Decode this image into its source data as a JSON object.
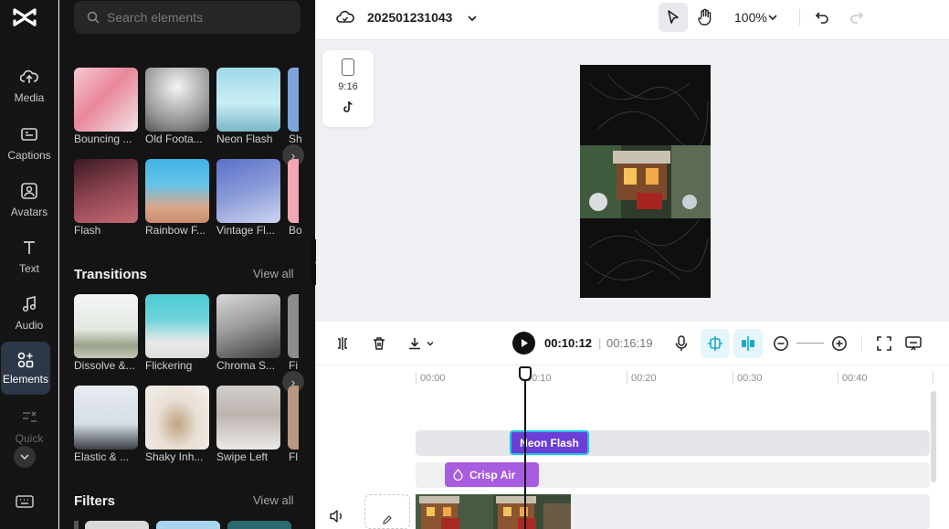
{
  "rail": {
    "items": [
      {
        "label": "Media",
        "icon": "cloud-upload-icon"
      },
      {
        "label": "Captions",
        "icon": "captions-icon"
      },
      {
        "label": "Avatars",
        "icon": "avatar-icon"
      },
      {
        "label": "Text",
        "icon": "text-icon"
      },
      {
        "label": "Audio",
        "icon": "music-note-icon"
      },
      {
        "label": "Elements",
        "icon": "elements-icon",
        "active": true
      },
      {
        "label": "Quick",
        "icon": "quick-tools-icon"
      }
    ]
  },
  "panel": {
    "search_placeholder": "Search elements",
    "effects_row1": [
      "Bouncing ...",
      "Old Foota...",
      "Neon Flash",
      "Sh"
    ],
    "effects_row2": [
      "Flash",
      "Rainbow F...",
      "Vintage Fl...",
      "Bo"
    ],
    "transitions": {
      "title": "Transitions",
      "view_all": "View all",
      "row1": [
        "Dissolve &...",
        "Flickering",
        "Chroma S...",
        "Fi"
      ],
      "row2": [
        "Elastic & ...",
        "Shaky Inh...",
        "Swipe Left",
        "Fl"
      ]
    },
    "filters": {
      "title": "Filters",
      "view_all": "View all"
    }
  },
  "topbar": {
    "project_title": "202501231043",
    "zoom": "100%"
  },
  "canvas": {
    "aspect_ratio": "9:16"
  },
  "timeline": {
    "current_time": "00:10:12",
    "separator": "|",
    "total_time": "00:16:19",
    "ruler_ticks": [
      "00:00",
      "00:10",
      "00:20",
      "00:30",
      "00:40"
    ],
    "clips": {
      "effect": "Neon Flash",
      "transition": "Crisp Air"
    }
  },
  "colors": {
    "accent": "#19a9c9",
    "effect_clip": "#6b3fd6",
    "transition_clip": "#a85ce0",
    "panel_bg": "#141414"
  }
}
